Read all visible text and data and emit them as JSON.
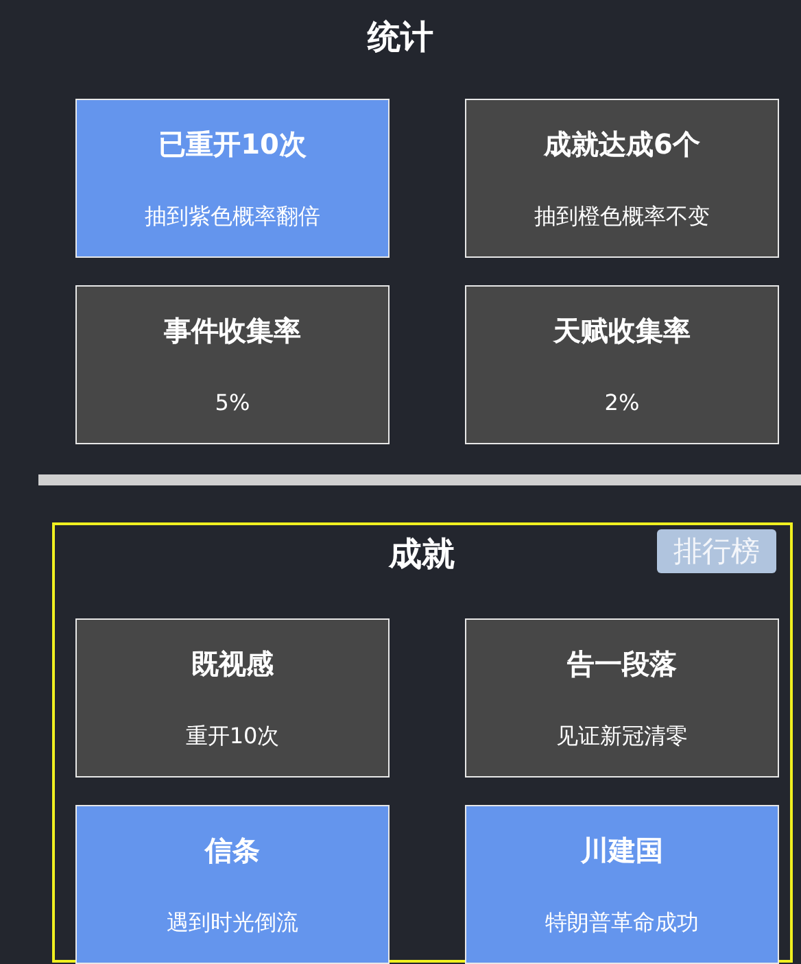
{
  "stats": {
    "title": "统计",
    "cards": [
      {
        "title": "已重开10次",
        "subtitle": "抽到紫色概率翻倍",
        "highlighted": true
      },
      {
        "title": "成就达成6个",
        "subtitle": "抽到橙色概率不变",
        "highlighted": false
      },
      {
        "title": "事件收集率",
        "subtitle": "5%",
        "highlighted": false
      },
      {
        "title": "天赋收集率",
        "subtitle": "2%",
        "highlighted": false
      }
    ]
  },
  "achievements": {
    "title": "成就",
    "ranking_button": "排行榜",
    "cards": [
      {
        "title": "既视感",
        "subtitle": "重开10次",
        "highlighted": false
      },
      {
        "title": "告一段落",
        "subtitle": "见证新冠清零",
        "highlighted": false
      },
      {
        "title": "信条",
        "subtitle": "遇到时光倒流",
        "highlighted": true
      },
      {
        "title": "川建国",
        "subtitle": "特朗普革命成功",
        "highlighted": true
      }
    ]
  }
}
